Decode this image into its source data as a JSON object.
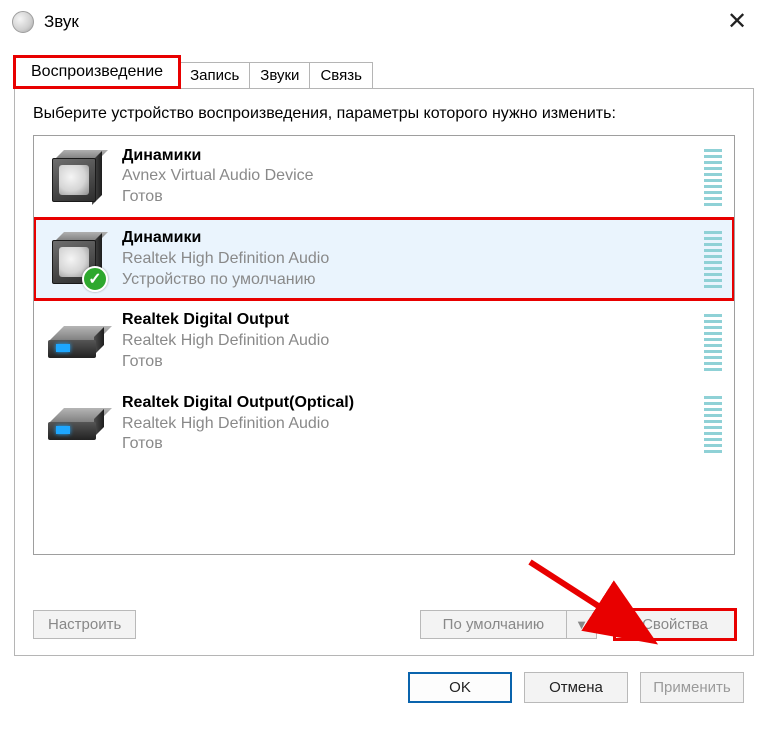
{
  "window": {
    "title": "Звук",
    "close_icon": "✕"
  },
  "tabs": [
    {
      "label": "Воспроизведение",
      "active": true
    },
    {
      "label": "Запись",
      "active": false
    },
    {
      "label": "Звуки",
      "active": false
    },
    {
      "label": "Связь",
      "active": false
    }
  ],
  "instruction": "Выберите устройство воспроизведения, параметры которого нужно изменить:",
  "devices": [
    {
      "icon": "speaker",
      "title": "Динамики",
      "subtitle": "Avnex Virtual Audio Device",
      "state": "Готов",
      "selected": false,
      "default": false
    },
    {
      "icon": "speaker",
      "title": "Динамики",
      "subtitle": "Realtek High Definition Audio",
      "state": "Устройство по умолчанию",
      "selected": true,
      "default": true
    },
    {
      "icon": "digital",
      "title": "Realtek Digital Output",
      "subtitle": "Realtek High Definition Audio",
      "state": "Готов",
      "selected": false,
      "default": false
    },
    {
      "icon": "digital",
      "title": "Realtek Digital Output(Optical)",
      "subtitle": "Realtek High Definition Audio",
      "state": "Готов",
      "selected": false,
      "default": false
    }
  ],
  "panel_buttons": {
    "configure": "Настроить",
    "default": "По умолчанию",
    "properties": "Свойства"
  },
  "dialog_buttons": {
    "ok": "OK",
    "cancel": "Отмена",
    "apply": "Применить"
  },
  "annotations": {
    "highlight_color": "#e80000"
  }
}
